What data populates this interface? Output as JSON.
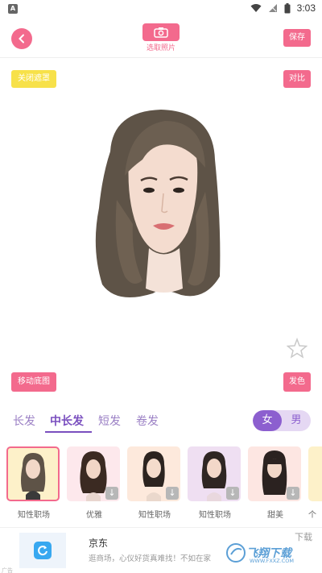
{
  "status_bar": {
    "time": "3:03",
    "app_icon": "A"
  },
  "header": {
    "back_icon": "chevron-left-icon",
    "camera_icon": "camera-icon",
    "camera_label": "选取照片",
    "save_label": "保存"
  },
  "canvas": {
    "mask_label": "关闭遮罩",
    "compare_label": "对比",
    "move_bg_label": "移动底图",
    "hair_color_label": "发色",
    "favorite_icon": "star-icon"
  },
  "tabs": [
    {
      "label": "长发",
      "active": false
    },
    {
      "label": "中长发",
      "active": true
    },
    {
      "label": "短发",
      "active": false
    },
    {
      "label": "卷发",
      "active": false
    }
  ],
  "gender": {
    "female": "女",
    "male": "男",
    "selected": "女"
  },
  "styles": [
    {
      "label": "知性职场",
      "bg": "#fdf1c9",
      "selected": true,
      "downloadable": false
    },
    {
      "label": "优雅",
      "bg": "#fde8ec",
      "selected": false,
      "downloadable": true
    },
    {
      "label": "知性职场",
      "bg": "#fde9dc",
      "selected": false,
      "downloadable": true
    },
    {
      "label": "知性职场",
      "bg": "#efdff2",
      "selected": false,
      "downloadable": true
    },
    {
      "label": "甜美",
      "bg": "#fde6e2",
      "selected": false,
      "downloadable": true
    },
    {
      "label": "个",
      "bg": "#fdf1c9",
      "selected": false,
      "downloadable": false
    }
  ],
  "ad": {
    "badge": "广告",
    "title": "京东",
    "description": "逛商场，心仪好货真难找！不如在家",
    "close": "下载",
    "watermark": "飞翔下载",
    "watermark_sub": "WWW.FXXZ.COM"
  },
  "colors": {
    "accent_pink": "#f36a8d",
    "accent_purple": "#8c5fcf",
    "mask_yellow": "#f7e14a"
  }
}
